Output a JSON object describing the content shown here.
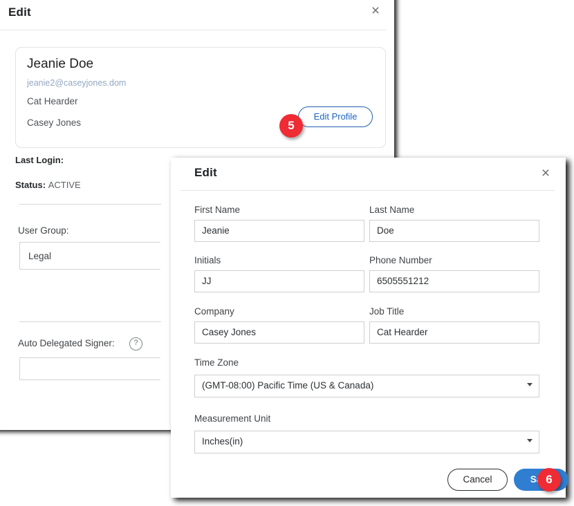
{
  "back_panel": {
    "title": "Edit",
    "close_icon": "close-icon",
    "profile": {
      "name": "Jeanie Doe",
      "email": "jeanie2@caseyjones.dom",
      "job_title": "Cat Hearder",
      "company": "Casey Jones",
      "edit_profile_label": "Edit Profile"
    },
    "details": {
      "last_login_label": "Last Login:",
      "status_label": "Status:",
      "status_value": "ACTIVE",
      "user_group_label": "User Group:",
      "user_group_value": "Legal",
      "auto_delegated_signer_label": "Auto Delegated Signer:",
      "auto_delegated_signer_value": "",
      "help_icon_glyph": "?"
    }
  },
  "front_dialog": {
    "title": "Edit",
    "close_icon": "close-icon",
    "fields": {
      "first_name_label": "First Name",
      "first_name_value": "Jeanie",
      "last_name_label": "Last Name",
      "last_name_value": "Doe",
      "initials_label": "Initials",
      "initials_value": "JJ",
      "phone_label": "Phone Number",
      "phone_value": "6505551212",
      "company_label": "Company",
      "company_value": "Casey Jones",
      "job_title_label": "Job Title",
      "job_title_value": "Cat Hearder",
      "time_zone_label": "Time Zone",
      "time_zone_value": "(GMT-08:00) Pacific Time (US & Canada)",
      "measurement_unit_label": "Measurement Unit",
      "measurement_unit_value": "Inches(in)"
    },
    "actions": {
      "cancel_label": "Cancel",
      "save_label": "Save"
    }
  },
  "callouts": {
    "step_five": "5",
    "step_six": "6"
  },
  "colors": {
    "badge_red": "#ef2b33",
    "save_blue": "#2f7ed1",
    "link_blue": "#1b63c4",
    "email_gray_blue": "#92a8c0"
  }
}
